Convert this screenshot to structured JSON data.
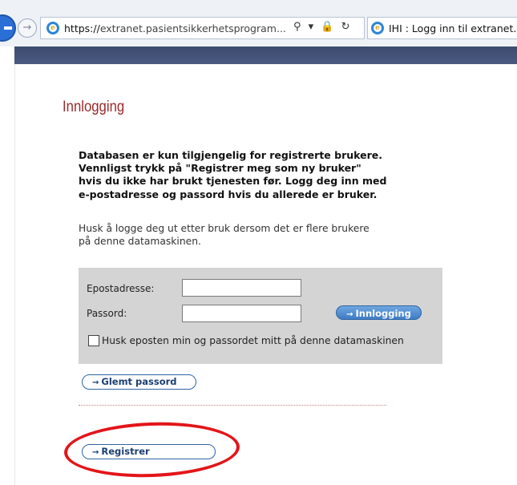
{
  "browser": {
    "url": "https://extranet.pasientsikkerhetsprogram...",
    "url_scheme": "https://",
    "url_host": "extranet.pasientsikkerhetsprogram...",
    "addr_actions": {
      "search": "⚲",
      "dropdown": "▾",
      "lock": "🔒",
      "refresh": "↻"
    },
    "tab_title": "IHI : Logg inn til extranet.p"
  },
  "page": {
    "heading": "Innlogging",
    "intro": "Databasen er kun tilgjengelig for registrerte brukere.\nVennligst trykk på \"Registrer meg som ny bruker\"\nhvis du ikke har brukt tjenesten før. Logg deg inn med\ne-postadresse og passord hvis du allerede er bruker.",
    "note": "Husk å logge deg ut etter bruk dersom det er flere brukere\npå denne datamaskinen."
  },
  "login_form": {
    "email_label": "Epostadresse:",
    "email_value": "",
    "password_label": "Passord:",
    "password_value": "",
    "submit_label": "Innlogging",
    "remember_label": "Husk eposten min og passordet mitt på denne datamaskinen",
    "remember_checked": false
  },
  "links": {
    "forgot_label": "Glemt passord",
    "register_label": "Registrer"
  },
  "icons": {
    "arrow": "→",
    "forward": "→"
  },
  "colors": {
    "heading": "#9a2a2a",
    "login_box_bg": "#d4d4d4",
    "button_blue": "#3e7cc4",
    "annotation_circle": "#e3151a",
    "top_bar": "#3c4b6f"
  }
}
